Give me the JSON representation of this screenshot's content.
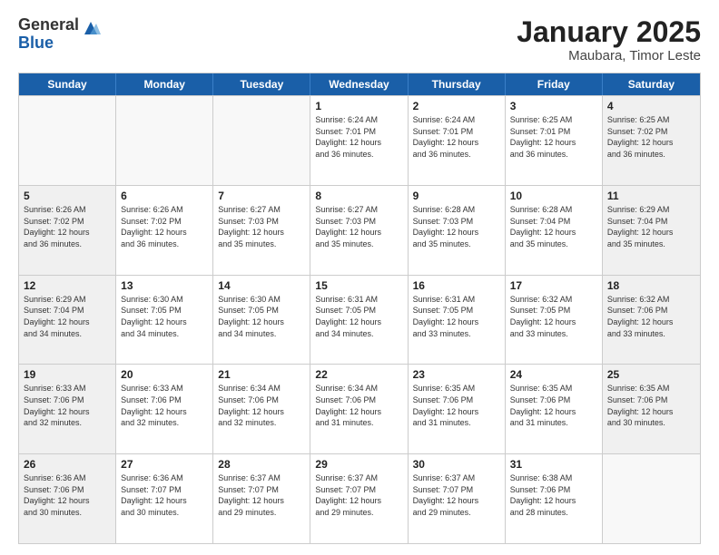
{
  "header": {
    "logo_general": "General",
    "logo_blue": "Blue",
    "month_title": "January 2025",
    "subtitle": "Maubara, Timor Leste"
  },
  "weekdays": [
    "Sunday",
    "Monday",
    "Tuesday",
    "Wednesday",
    "Thursday",
    "Friday",
    "Saturday"
  ],
  "weeks": [
    [
      {
        "day": "",
        "info": "",
        "empty": true
      },
      {
        "day": "",
        "info": "",
        "empty": true
      },
      {
        "day": "",
        "info": "",
        "empty": true
      },
      {
        "day": "1",
        "info": "Sunrise: 6:24 AM\nSunset: 7:01 PM\nDaylight: 12 hours\nand 36 minutes."
      },
      {
        "day": "2",
        "info": "Sunrise: 6:24 AM\nSunset: 7:01 PM\nDaylight: 12 hours\nand 36 minutes."
      },
      {
        "day": "3",
        "info": "Sunrise: 6:25 AM\nSunset: 7:01 PM\nDaylight: 12 hours\nand 36 minutes."
      },
      {
        "day": "4",
        "info": "Sunrise: 6:25 AM\nSunset: 7:02 PM\nDaylight: 12 hours\nand 36 minutes.",
        "shaded": true
      }
    ],
    [
      {
        "day": "5",
        "info": "Sunrise: 6:26 AM\nSunset: 7:02 PM\nDaylight: 12 hours\nand 36 minutes.",
        "shaded": true
      },
      {
        "day": "6",
        "info": "Sunrise: 6:26 AM\nSunset: 7:02 PM\nDaylight: 12 hours\nand 36 minutes."
      },
      {
        "day": "7",
        "info": "Sunrise: 6:27 AM\nSunset: 7:03 PM\nDaylight: 12 hours\nand 35 minutes."
      },
      {
        "day": "8",
        "info": "Sunrise: 6:27 AM\nSunset: 7:03 PM\nDaylight: 12 hours\nand 35 minutes."
      },
      {
        "day": "9",
        "info": "Sunrise: 6:28 AM\nSunset: 7:03 PM\nDaylight: 12 hours\nand 35 minutes."
      },
      {
        "day": "10",
        "info": "Sunrise: 6:28 AM\nSunset: 7:04 PM\nDaylight: 12 hours\nand 35 minutes."
      },
      {
        "day": "11",
        "info": "Sunrise: 6:29 AM\nSunset: 7:04 PM\nDaylight: 12 hours\nand 35 minutes.",
        "shaded": true
      }
    ],
    [
      {
        "day": "12",
        "info": "Sunrise: 6:29 AM\nSunset: 7:04 PM\nDaylight: 12 hours\nand 34 minutes.",
        "shaded": true
      },
      {
        "day": "13",
        "info": "Sunrise: 6:30 AM\nSunset: 7:05 PM\nDaylight: 12 hours\nand 34 minutes."
      },
      {
        "day": "14",
        "info": "Sunrise: 6:30 AM\nSunset: 7:05 PM\nDaylight: 12 hours\nand 34 minutes."
      },
      {
        "day": "15",
        "info": "Sunrise: 6:31 AM\nSunset: 7:05 PM\nDaylight: 12 hours\nand 34 minutes."
      },
      {
        "day": "16",
        "info": "Sunrise: 6:31 AM\nSunset: 7:05 PM\nDaylight: 12 hours\nand 33 minutes."
      },
      {
        "day": "17",
        "info": "Sunrise: 6:32 AM\nSunset: 7:05 PM\nDaylight: 12 hours\nand 33 minutes."
      },
      {
        "day": "18",
        "info": "Sunrise: 6:32 AM\nSunset: 7:06 PM\nDaylight: 12 hours\nand 33 minutes.",
        "shaded": true
      }
    ],
    [
      {
        "day": "19",
        "info": "Sunrise: 6:33 AM\nSunset: 7:06 PM\nDaylight: 12 hours\nand 32 minutes.",
        "shaded": true
      },
      {
        "day": "20",
        "info": "Sunrise: 6:33 AM\nSunset: 7:06 PM\nDaylight: 12 hours\nand 32 minutes."
      },
      {
        "day": "21",
        "info": "Sunrise: 6:34 AM\nSunset: 7:06 PM\nDaylight: 12 hours\nand 32 minutes."
      },
      {
        "day": "22",
        "info": "Sunrise: 6:34 AM\nSunset: 7:06 PM\nDaylight: 12 hours\nand 31 minutes."
      },
      {
        "day": "23",
        "info": "Sunrise: 6:35 AM\nSunset: 7:06 PM\nDaylight: 12 hours\nand 31 minutes."
      },
      {
        "day": "24",
        "info": "Sunrise: 6:35 AM\nSunset: 7:06 PM\nDaylight: 12 hours\nand 31 minutes."
      },
      {
        "day": "25",
        "info": "Sunrise: 6:35 AM\nSunset: 7:06 PM\nDaylight: 12 hours\nand 30 minutes.",
        "shaded": true
      }
    ],
    [
      {
        "day": "26",
        "info": "Sunrise: 6:36 AM\nSunset: 7:06 PM\nDaylight: 12 hours\nand 30 minutes.",
        "shaded": true
      },
      {
        "day": "27",
        "info": "Sunrise: 6:36 AM\nSunset: 7:07 PM\nDaylight: 12 hours\nand 30 minutes."
      },
      {
        "day": "28",
        "info": "Sunrise: 6:37 AM\nSunset: 7:07 PM\nDaylight: 12 hours\nand 29 minutes."
      },
      {
        "day": "29",
        "info": "Sunrise: 6:37 AM\nSunset: 7:07 PM\nDaylight: 12 hours\nand 29 minutes."
      },
      {
        "day": "30",
        "info": "Sunrise: 6:37 AM\nSunset: 7:07 PM\nDaylight: 12 hours\nand 29 minutes."
      },
      {
        "day": "31",
        "info": "Sunrise: 6:38 AM\nSunset: 7:06 PM\nDaylight: 12 hours\nand 28 minutes."
      },
      {
        "day": "",
        "info": "",
        "empty": true,
        "shaded": true
      }
    ]
  ]
}
